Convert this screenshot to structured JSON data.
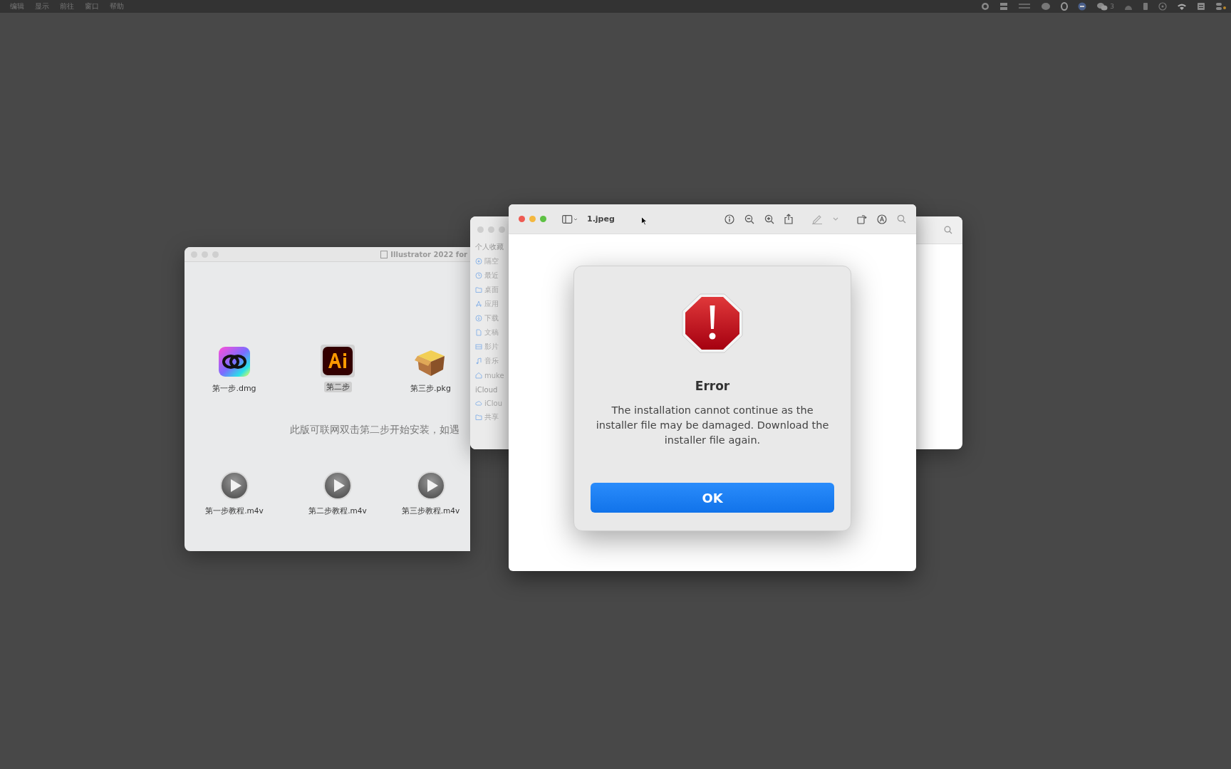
{
  "menu_bar": {
    "menus": [
      "编辑",
      "显示",
      "前往",
      "窗口",
      "帮助"
    ],
    "chat_badge": "3"
  },
  "finder_window": {
    "title": "Illustrator 2022 for",
    "items": [
      {
        "name": "第一步.dmg",
        "kind": "cc",
        "selected": false
      },
      {
        "name": "第二步",
        "kind": "ai",
        "selected": true
      },
      {
        "name": "第三步.pkg",
        "kind": "package",
        "selected": false
      }
    ],
    "note": "此版可联网双击第二步开始安装，如遇",
    "videos": [
      {
        "name": "第一步教程.m4v",
        "kind": "video",
        "selected": false
      },
      {
        "name": "第二步教程.m4v",
        "kind": "video",
        "selected": false
      },
      {
        "name": "第三步教程.m4v",
        "kind": "video",
        "selected": false
      }
    ]
  },
  "sidebar_window": {
    "sections": [
      {
        "header": "个人收藏",
        "items": [
          {
            "label": "隔空",
            "kind": "airdrop"
          },
          {
            "label": "最近",
            "kind": "clock"
          },
          {
            "label": "桌面",
            "kind": "folder"
          },
          {
            "label": "应用",
            "kind": "apps"
          },
          {
            "label": "下载",
            "kind": "download"
          },
          {
            "label": "文稿",
            "kind": "doc"
          },
          {
            "label": "影片",
            "kind": "film"
          },
          {
            "label": "音乐",
            "kind": "music"
          },
          {
            "label": "muke",
            "kind": "home"
          }
        ]
      },
      {
        "header": "iCloud",
        "items": [
          {
            "label": "iClou",
            "kind": "cloud"
          },
          {
            "label": "共享",
            "kind": "folder"
          }
        ]
      }
    ]
  },
  "preview_window": {
    "title": "1.jpeg"
  },
  "dialog": {
    "title": "Error",
    "message": "The installation cannot continue as the installer file may be damaged. Download the installer file again.",
    "button": "OK"
  }
}
